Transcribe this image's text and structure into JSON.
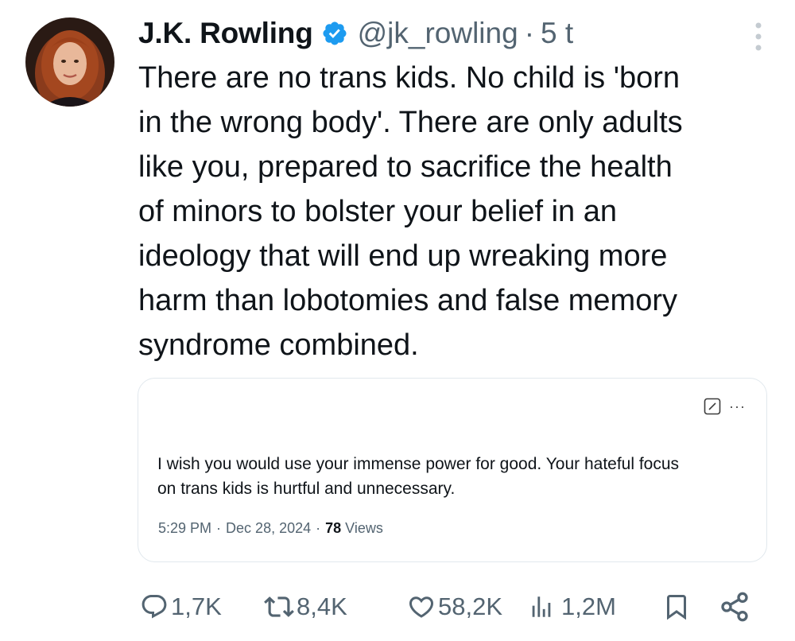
{
  "author": {
    "name": "J.K. Rowling",
    "handle": "@jk_rowling",
    "separator": "·",
    "time": "5 t",
    "verified_color": "#1d9bf0"
  },
  "tweet": {
    "text": "There are no trans kids. No child is 'born\nin the wrong body'. There are only adults\nlike you, prepared to sacrifice the health\nof minors to bolster your belief in an\nideology that will end up wreaking more\nharm than lobotomies and false memory\nsyndrome combined."
  },
  "quoted": {
    "text": "I wish you would use your immense power for good. Your hateful focus\non trans kids is hurtful and unnecessary.",
    "time": "5:29 PM",
    "separator": "·",
    "date": "Dec 28, 2024",
    "views_count": "78",
    "views_label": "Views",
    "more_label": "···"
  },
  "actions": {
    "replies": "1,7K",
    "reposts": "8,4K",
    "likes": "58,2K",
    "views": "1,2M"
  },
  "icons": {
    "more": "more-vertical-icon",
    "verified": "verified-badge-icon",
    "reply": "reply-icon",
    "repost": "repost-icon",
    "like": "heart-icon",
    "views": "views-bar-chart-icon",
    "bookmark": "bookmark-icon",
    "share": "share-icon",
    "edit": "edit-icon"
  },
  "colors": {
    "text": "#0f1419",
    "secondary": "#536471",
    "accent": "#1d9bf0",
    "border": "#e1e8ed"
  }
}
